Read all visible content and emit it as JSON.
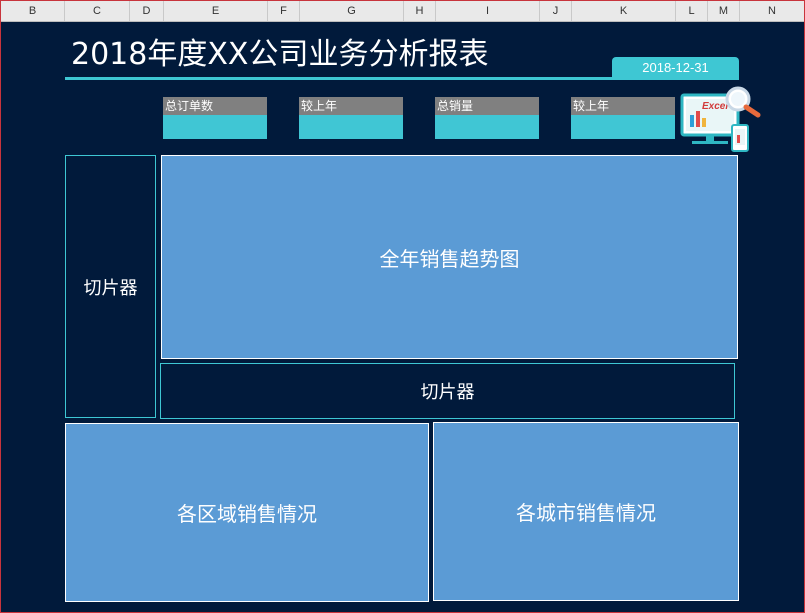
{
  "spreadsheet": {
    "column_headers": [
      "B",
      "C",
      "D",
      "E",
      "F",
      "G",
      "H",
      "I",
      "J",
      "K",
      "L",
      "M",
      "N"
    ]
  },
  "dashboard": {
    "title": "2018年度XX公司业务分析报表",
    "date": "2018-12-31",
    "kpis": [
      {
        "label": "总订单数"
      },
      {
        "label": "较上年"
      },
      {
        "label": "总销量"
      },
      {
        "label": "较上年"
      }
    ],
    "logo": {
      "text": "Excel",
      "icon": "computer-magnifier-logo-icon"
    },
    "slicer_left_label": "切片器",
    "trend_chart_label": "全年销售趋势图",
    "slicer_bottom_label": "切片器",
    "region_chart_label": "各区域销售情况",
    "city_chart_label": "各城市销售情况"
  },
  "colors": {
    "background": "#011a3b",
    "accent_cyan": "#3ec7d3",
    "panel_blue": "#5b9bd5",
    "kpi_label_gray": "#808080"
  }
}
